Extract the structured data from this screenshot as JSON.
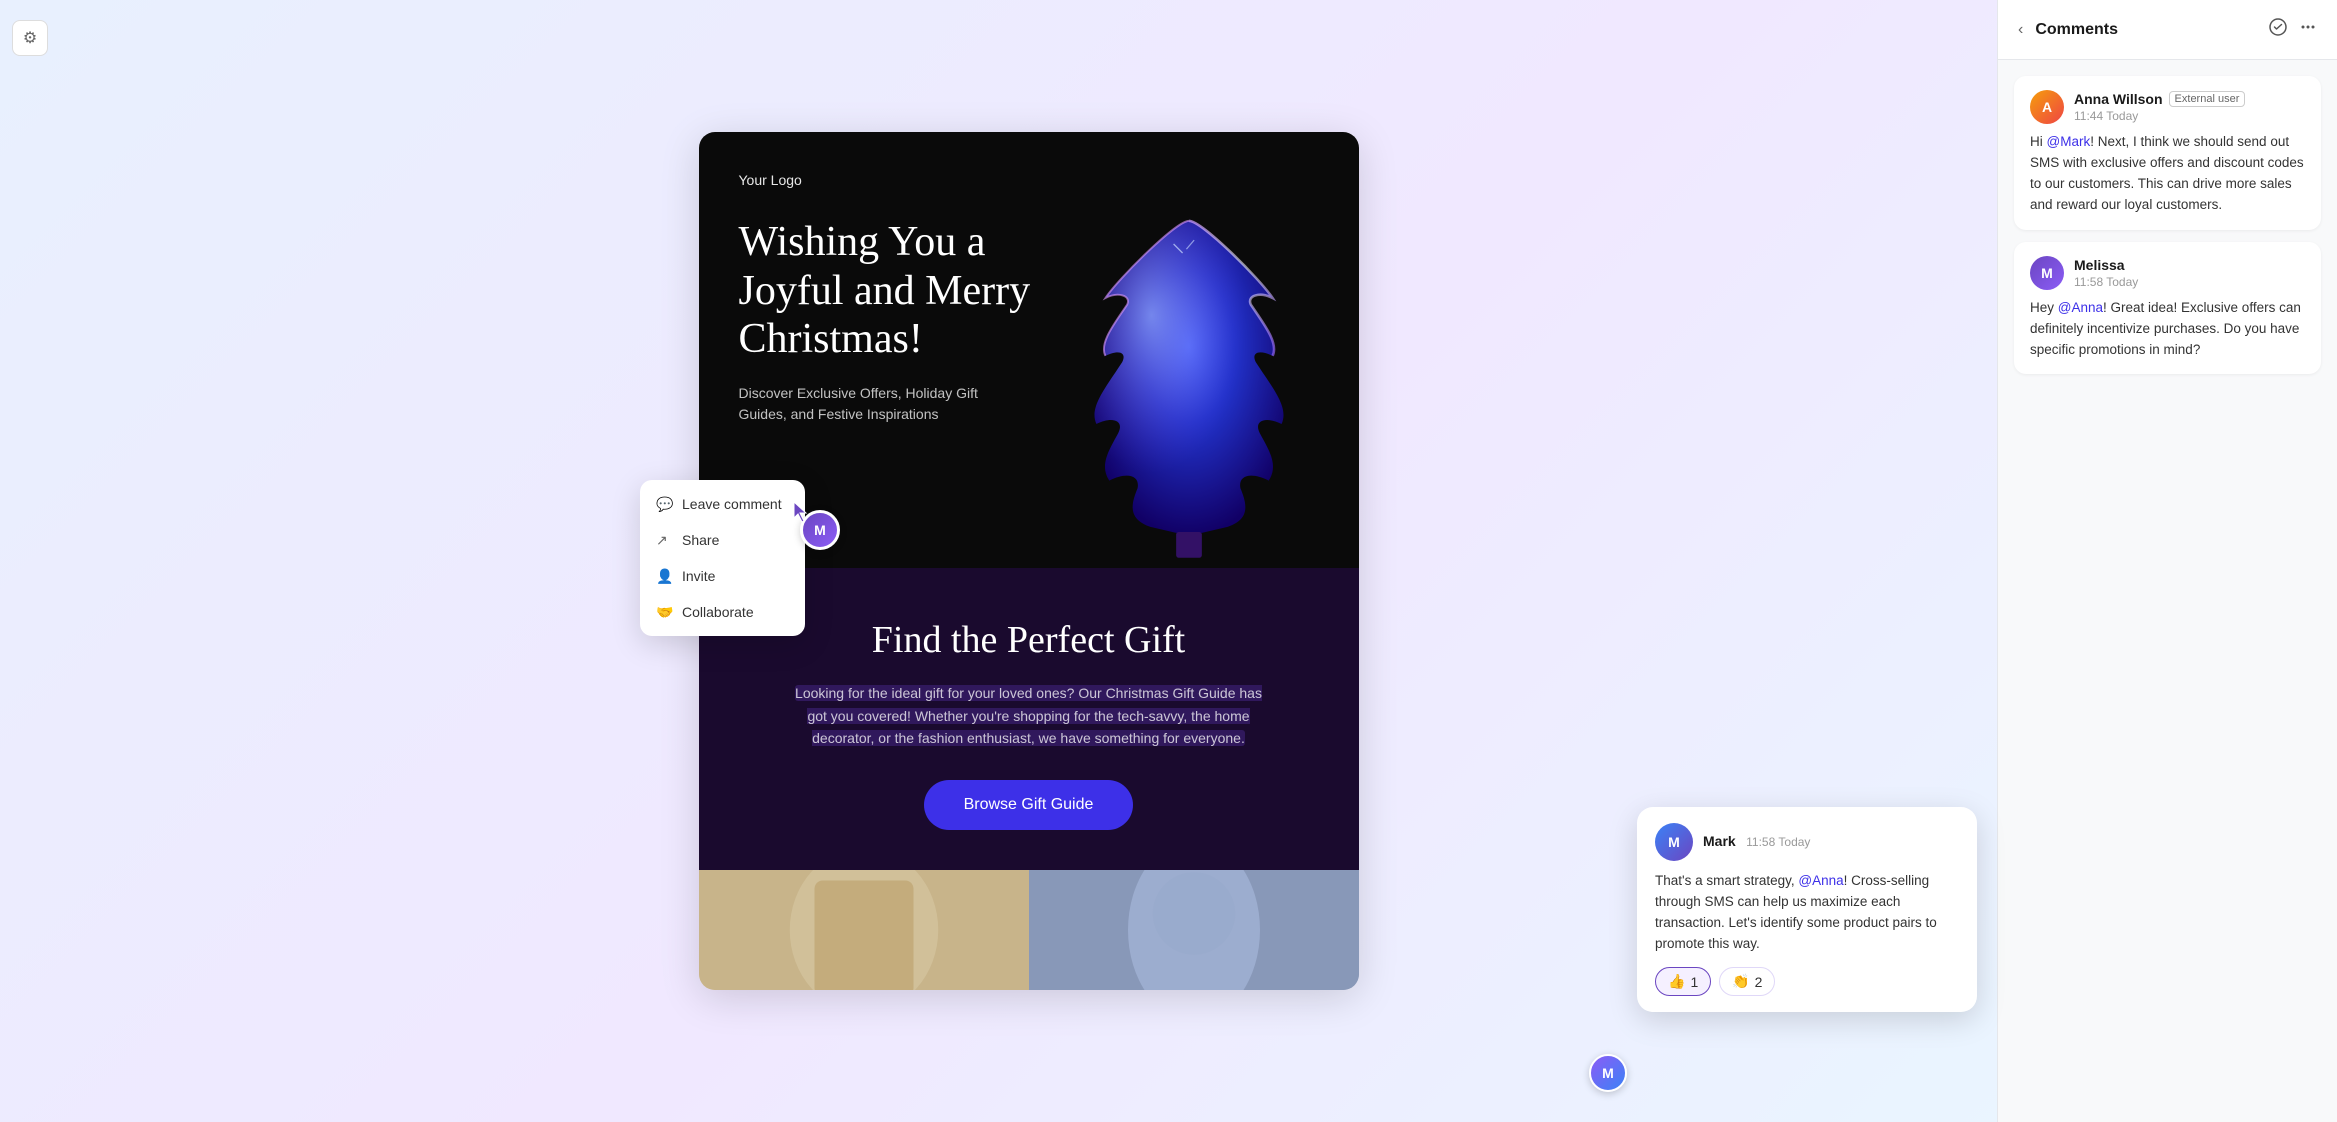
{
  "sidebar": {
    "gear_label": "⚙"
  },
  "canvas": {
    "logo": "Your Logo",
    "hero_title": "Wishing You a Joyful and Merry Christmas!",
    "hero_subtitle": "Discover Exclusive Offers, Holiday Gift Guides, and Festive Inspirations",
    "gift_section_title": "Find the Perfect Gift",
    "gift_text": "Looking for the ideal gift for your loved ones? Our Christmas Gift Guide has got you covered! Whether you're shopping for the tech-savvy, the home decorator, or the fashion enthusiast, we have something for everyone.",
    "browse_btn": "Browse Gift Guide"
  },
  "context_menu": {
    "items": [
      {
        "icon": "💬",
        "label": "Leave comment"
      },
      {
        "icon": "↗",
        "label": "Share"
      },
      {
        "icon": "👤",
        "label": "Invite"
      },
      {
        "icon": "🤝",
        "label": "Collaborate"
      }
    ]
  },
  "comments_panel": {
    "title": "Comments",
    "back_label": "‹",
    "comments": [
      {
        "author": "Anna Willson",
        "badge": "External user",
        "time": "11:44 Today",
        "text": "Hi @Mark! Next, I think we should send out SMS with exclusive offers and discount codes to our customers. This can drive more sales and reward our loyal customers.",
        "mention": "@Mark"
      },
      {
        "author": "Melissa",
        "badge": "",
        "time": "11:58 Today",
        "text": "Hey @Anna! Great idea! Exclusive offers can definitely incentivize purchases. Do you have specific promotions in mind?",
        "mention": "@Anna"
      }
    ],
    "floating_comment": {
      "author": "Mark",
      "time": "11:58 Today",
      "text": "That's a smart strategy, @Anna! Cross-selling through SMS can help us maximize each transaction. Let's identify some product pairs to promote this way.",
      "mention": "@Anna",
      "reactions": [
        {
          "emoji": "👍",
          "count": "1",
          "active": true
        },
        {
          "emoji": "👏",
          "count": "2",
          "active": false
        }
      ]
    }
  }
}
